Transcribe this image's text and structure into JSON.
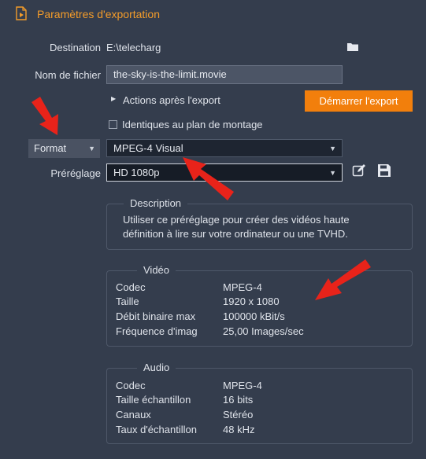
{
  "header": {
    "title": "Paramètres d'exportation"
  },
  "destination": {
    "label": "Destination",
    "value": "E:\\telecharg"
  },
  "filename": {
    "label": "Nom de fichier",
    "value": "the-sky-is-the-limit.movie"
  },
  "actions": {
    "label": "Actions après l'export"
  },
  "start_button": {
    "label": "Démarrer l'export"
  },
  "timeline_check": {
    "label": "Identiques au plan de montage",
    "checked": false
  },
  "format": {
    "button_label": "Format",
    "value": "MPEG-4 Visual"
  },
  "preset": {
    "label": "Préréglage",
    "value": "HD 1080p"
  },
  "description": {
    "title": "Description",
    "line1": "Utiliser ce préréglage pour créer des vidéos haute",
    "line2": "définition à lire sur votre ordinateur ou une TVHD."
  },
  "video": {
    "title": "Vidéo",
    "rows": [
      {
        "key": "Codec",
        "value": "MPEG-4"
      },
      {
        "key": "Taille",
        "value": "1920 x 1080"
      },
      {
        "key": "Débit binaire max",
        "value": "100000 kBit/s"
      },
      {
        "key": "Fréquence d'imag",
        "value": "25,00 Images/sec"
      }
    ]
  },
  "audio": {
    "title": "Audio",
    "rows": [
      {
        "key": "Codec",
        "value": "MPEG-4"
      },
      {
        "key": "Taille échantillon",
        "value": "16 bits"
      },
      {
        "key": "Canaux",
        "value": "Stéréo"
      },
      {
        "key": "Taux d'échantillon",
        "value": "48 kHz"
      }
    ]
  },
  "colors": {
    "accent": "#f27f0c",
    "title": "#f39c2a",
    "background": "#343d4d",
    "annotation_arrow": "#e8231a"
  }
}
